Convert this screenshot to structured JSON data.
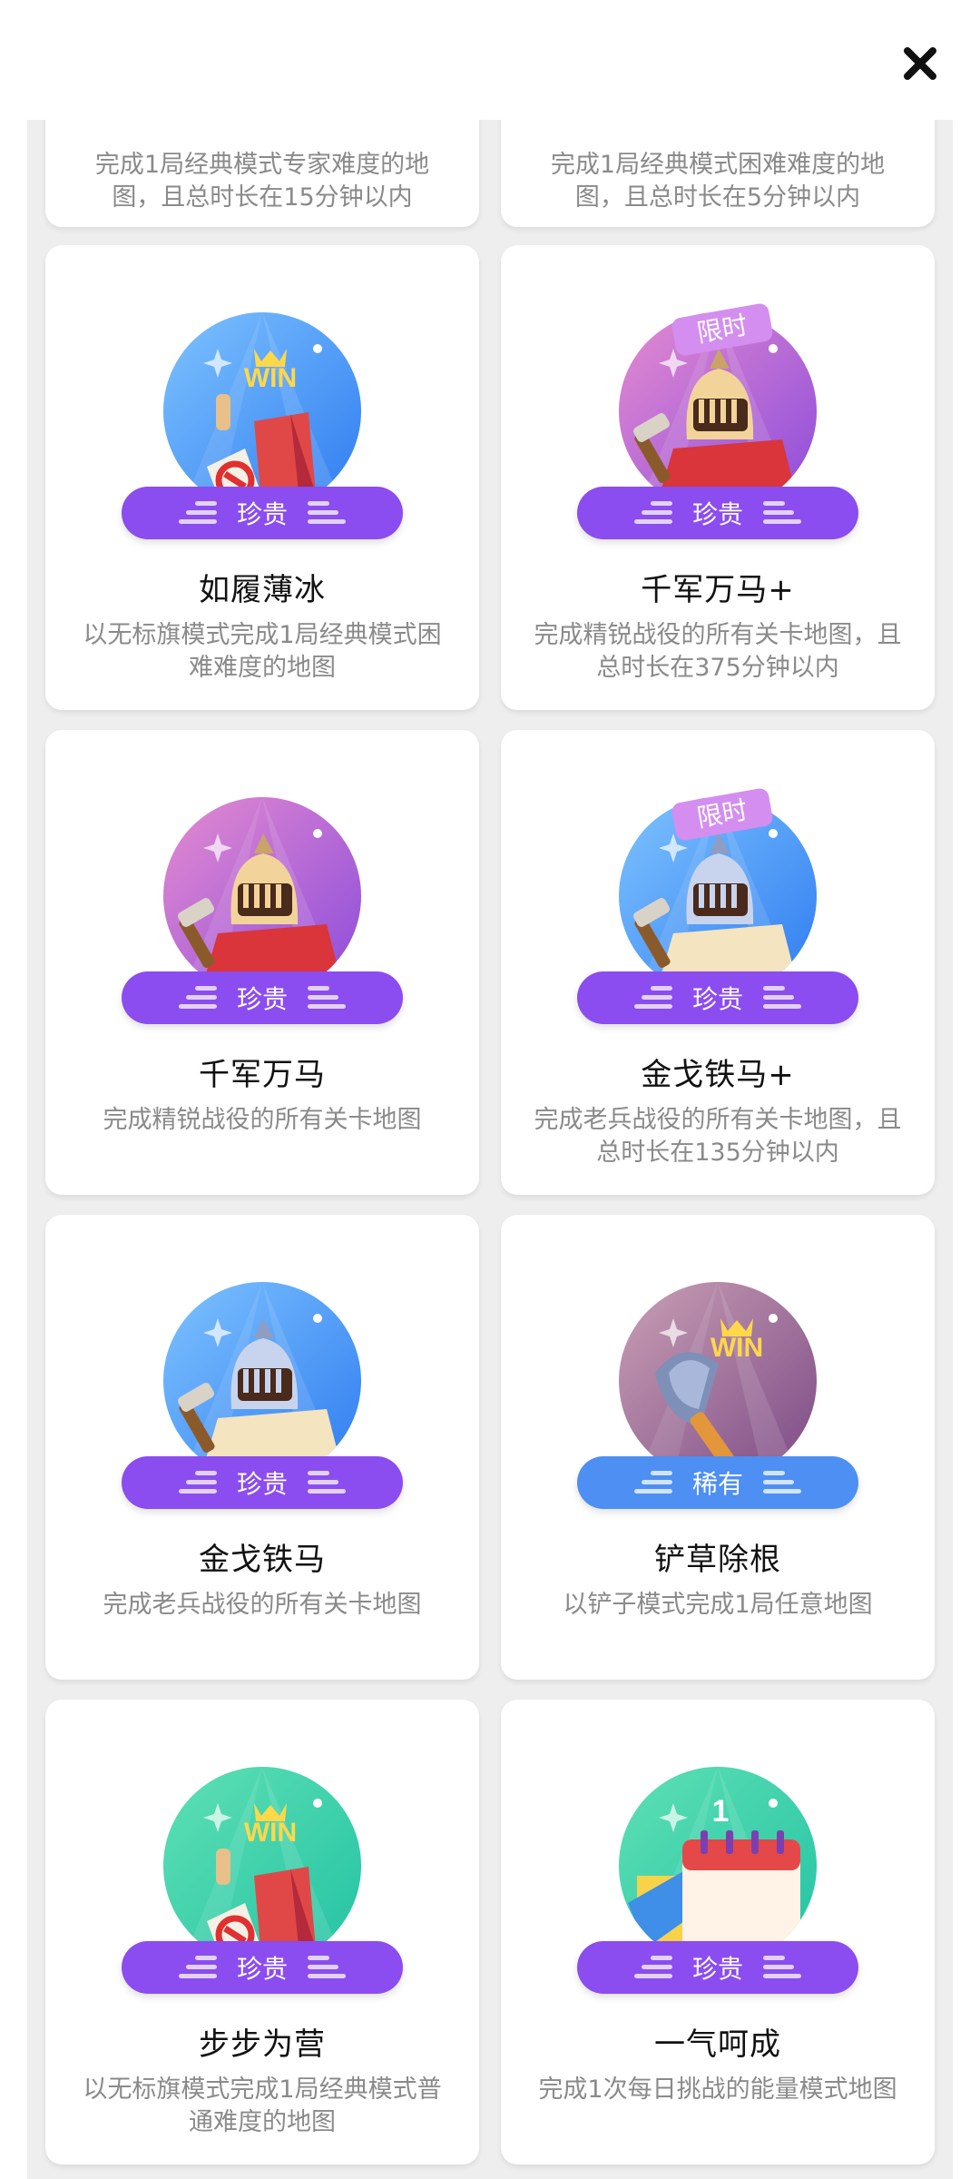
{
  "close_icon": "close-icon",
  "partial_cards": [
    {
      "desc": "完成1局经典模式专家难度的地图，且总时长在15分钟以内"
    },
    {
      "desc": "完成1局经典模式困难难度的地图，且总时长在5分钟以内"
    }
  ],
  "cards": [
    {
      "title": "如履薄冰",
      "desc": "以无标旗模式完成1局经典模式困难难度的地图",
      "rarity": "珍贵",
      "tag": "",
      "art": "win-flag",
      "theme": "blue"
    },
    {
      "title": "千军万马+",
      "desc": "完成精锐战役的所有关卡地图，且总时长在375分钟以内",
      "rarity": "珍贵",
      "tag": "限时",
      "art": "knight-gold",
      "theme": "purple"
    },
    {
      "title": "千军万马",
      "desc": "完成精锐战役的所有关卡地图",
      "rarity": "珍贵",
      "tag": "",
      "art": "knight-gold",
      "theme": "purple"
    },
    {
      "title": "金戈铁马+",
      "desc": "完成老兵战役的所有关卡地图，且总时长在135分钟以内",
      "rarity": "珍贵",
      "tag": "限时",
      "art": "knight-silver",
      "theme": "blue"
    },
    {
      "title": "金戈铁马",
      "desc": "完成老兵战役的所有关卡地图",
      "rarity": "珍贵",
      "tag": "",
      "art": "knight-silver",
      "theme": "blue"
    },
    {
      "title": "铲草除根",
      "desc": "以铲子模式完成1局任意地图",
      "rarity": "稀有",
      "tag": "",
      "art": "win-shovel",
      "theme": "mauve"
    },
    {
      "title": "步步为营",
      "desc": "以无标旗模式完成1局经典模式普通难度的地图",
      "rarity": "珍贵",
      "tag": "",
      "art": "win-flag",
      "theme": "green"
    },
    {
      "title": "一气呵成",
      "desc": "完成1次每日挑战的能量模式地图",
      "rarity": "珍贵",
      "tag": "",
      "art": "calendar",
      "theme": "green"
    }
  ],
  "badge_texts": {
    "win": "WIN",
    "calendar_day": "1"
  },
  "colors": {
    "rare_purple": "#8b4cf0",
    "rare_blue": "#4d8ff2"
  }
}
